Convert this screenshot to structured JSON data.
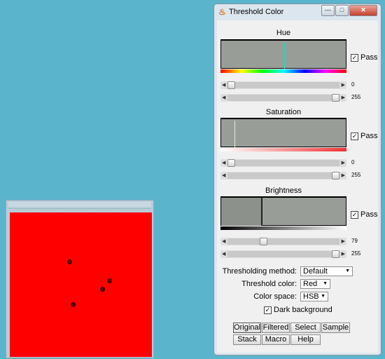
{
  "window": {
    "title": "Threshold Color",
    "min_icon": "minimize-icon",
    "max_icon": "maximize-icon",
    "close_icon": "close-icon"
  },
  "hue": {
    "title": "Hue",
    "pass_label": "Pass",
    "pass_checked": "✓",
    "min_value": "0",
    "max_value": "255",
    "min_fraction": 0.0,
    "max_fraction": 1.0
  },
  "saturation": {
    "title": "Saturation",
    "pass_label": "Pass",
    "pass_checked": "✓",
    "min_value": "0",
    "max_value": "255",
    "min_fraction": 0.0,
    "max_fraction": 1.0
  },
  "brightness": {
    "title": "Brightness",
    "pass_label": "Pass",
    "pass_checked": "✓",
    "min_value": "79",
    "max_value": "255",
    "min_fraction": 0.31,
    "max_fraction": 1.0
  },
  "options": {
    "method_label": "Thresholding method:",
    "method_value": "Default",
    "color_label": "Threshold color:",
    "color_value": "Red",
    "space_label": "Color space:",
    "space_value": "HSB",
    "dark_bg_label": "Dark background",
    "dark_bg_checked": "✓"
  },
  "buttons": {
    "original": "Original",
    "filtered": "Filtered",
    "select": "Select",
    "sample": "Sample",
    "stack": "Stack",
    "macro": "Macro",
    "help": "Help"
  },
  "colors": {
    "desktop": "#5ab4cc",
    "image_fill": "#ff0000",
    "histogram_bg": "#999d98"
  }
}
